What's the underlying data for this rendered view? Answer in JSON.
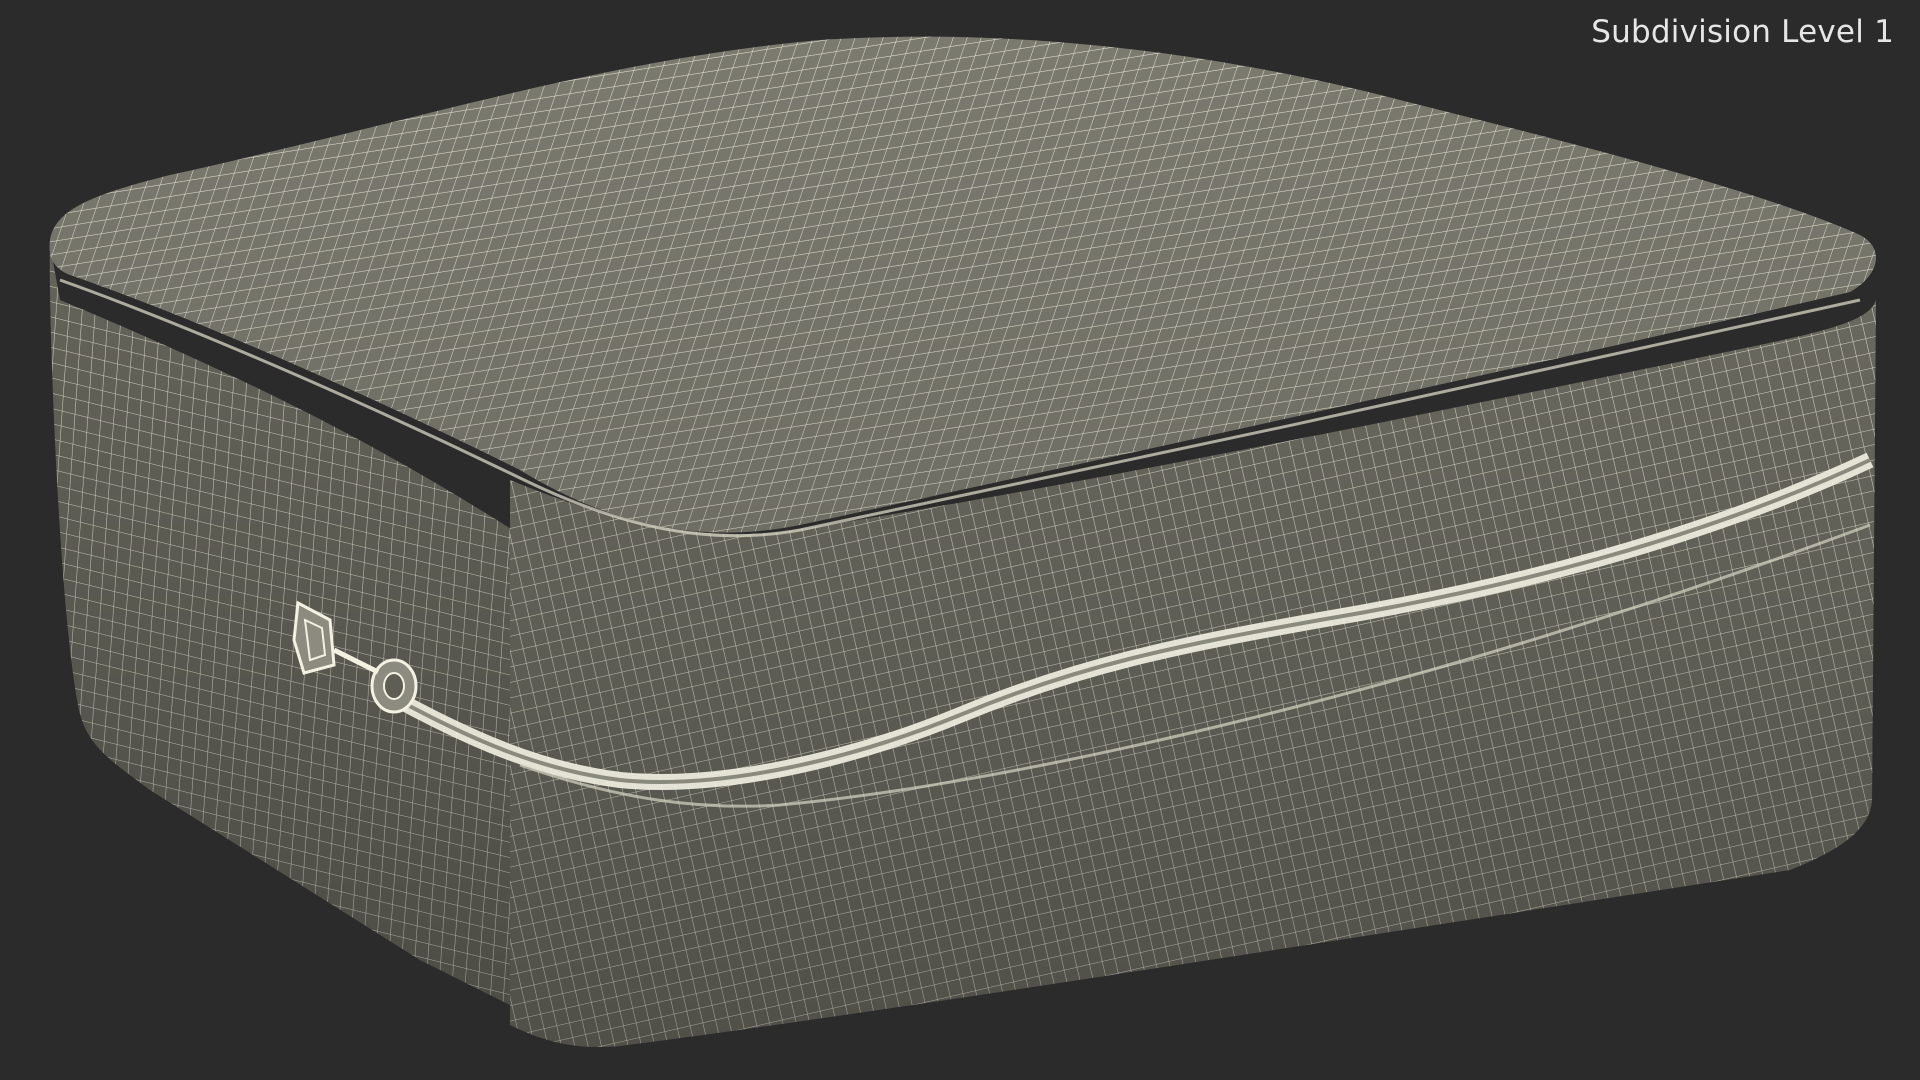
{
  "viewport": {
    "label": "Subdivision Level 1",
    "background_color": "#2b2b2b",
    "mesh_color": "#7d7c70",
    "wire_color": "#ecebdc"
  },
  "model": {
    "subject": "suitcase-wireframe",
    "icon": "suitcase-icon"
  }
}
